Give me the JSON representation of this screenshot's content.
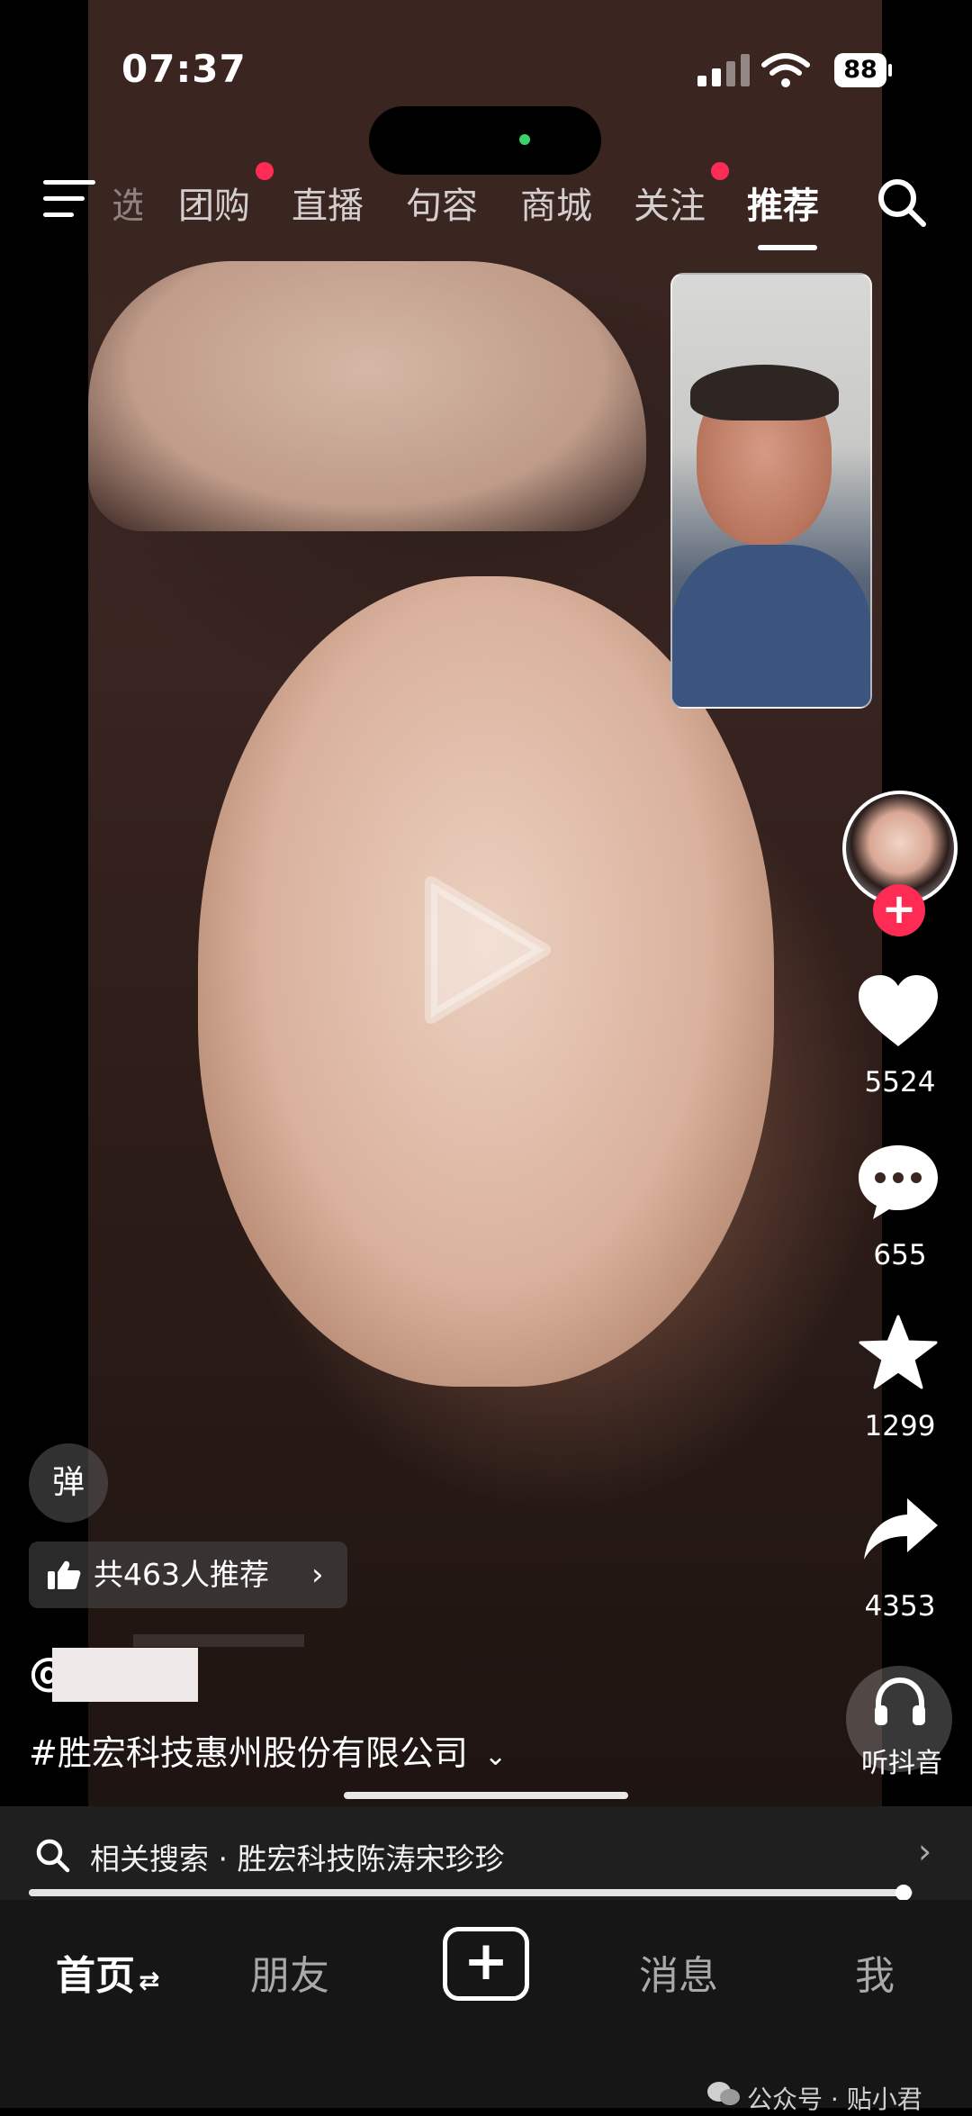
{
  "status_bar": {
    "time": "07:37",
    "battery": "88"
  },
  "top_nav": {
    "tabs": [
      {
        "label": "选",
        "partial": true
      },
      {
        "label": "团购",
        "badge": true
      },
      {
        "label": "直播"
      },
      {
        "label": "句容"
      },
      {
        "label": "商城"
      },
      {
        "label": "关注",
        "badge": true
      },
      {
        "label": "推荐",
        "active": true
      }
    ],
    "accent_color": "#fe2c55"
  },
  "video": {
    "state": "paused"
  },
  "right_rail": {
    "follow_symbol": "+",
    "likes": "5524",
    "comments": "655",
    "favorites": "1299",
    "shares": "4353",
    "listen_label": "听抖音"
  },
  "overlay": {
    "danmu_label": "弹",
    "recommend_text": "共463人推荐",
    "recommend_chevron": "›",
    "author_prefix": "@",
    "hashtag": "#胜宏科技惠州股份有限公司",
    "expand_icon": "⌄"
  },
  "related_search": {
    "text": "相关搜索 · 胜宏科技陈涛宋珍珍",
    "arrow": "›"
  },
  "playback": {
    "progress": 0.99
  },
  "bottom_nav": {
    "home": "首页",
    "home_switch": "⇄",
    "friends": "朋友",
    "create": "+",
    "messages": "消息",
    "me": "我"
  },
  "watermark": "公众号 · 贴小君"
}
